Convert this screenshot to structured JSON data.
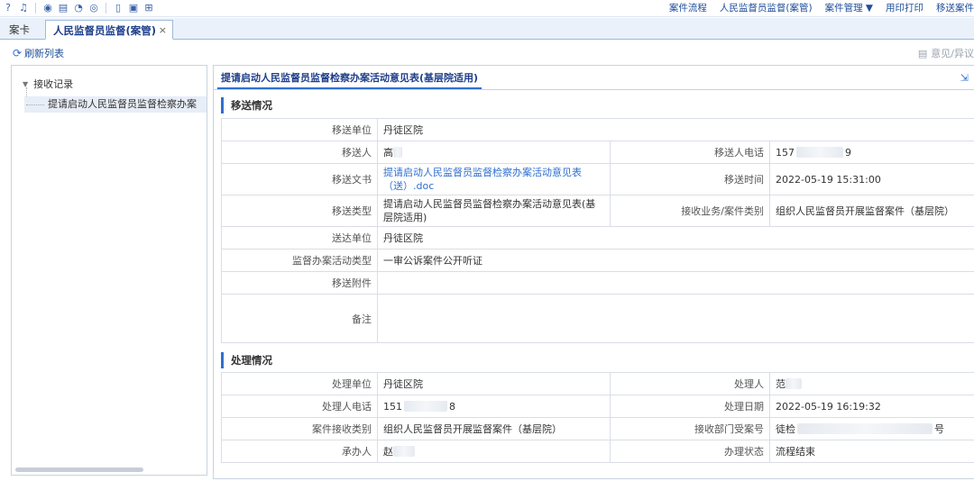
{
  "menu": {
    "items": [
      "案件流程",
      "人民监督员监督(案管)",
      "案件管理 ▼",
      "用印打印",
      "移送案件"
    ]
  },
  "tabs": {
    "tab1": "案卡",
    "tab2": "人民监督员监督(案管)",
    "close": "×"
  },
  "toolbar": {
    "refresh": "刷新列表",
    "opinion": "意见/异议"
  },
  "tree": {
    "root": "接收记录",
    "child": "提请启动人民监督员监督检察办案"
  },
  "form": {
    "tab_title": "提请启动人民监督员监督检察办案活动意见表(基层院适用)",
    "section1": "移送情况",
    "section2": "处理情况",
    "transfer": {
      "unit_label": "移送单位",
      "unit_value": "丹徒区院",
      "person_label": "移送人",
      "person_value": "高",
      "phone_label": "移送人电话",
      "phone_prefix": "157",
      "phone_suffix": "9",
      "doc_label": "移送文书",
      "doc_value": "提请启动人民监督员监督检察办案活动意见表（送）.doc",
      "time_label": "移送时间",
      "time_value": "2022-05-19 15:31:00",
      "type_label": "移送类型",
      "type_value": "提请启动人民监督员监督检察办案活动意见表(基层院适用)",
      "biz_label": "接收业务/案件类别",
      "biz_value": "组织人民监督员开展监督案件（基层院）",
      "deliver_label": "送达单位",
      "deliver_value": "丹徒区院",
      "activity_label": "监督办案活动类型",
      "activity_value": "一审公诉案件公开听证",
      "attach_label": "移送附件",
      "attach_value": "",
      "remark_label": "备注",
      "remark_value": ""
    },
    "process": {
      "unit_label": "处理单位",
      "unit_value": "丹徒区院",
      "person_label": "处理人",
      "person_value": "范",
      "phone_label": "处理人电话",
      "phone_prefix": "151",
      "phone_suffix": "8",
      "date_label": "处理日期",
      "date_value": "2022-05-19 16:19:32",
      "category_label": "案件接收类别",
      "category_value": "组织人民监督员开展监督案件（基层院）",
      "dept_label": "接收部门受案号",
      "dept_prefix": "徒检",
      "dept_suffix": "号",
      "handler_label": "承办人",
      "handler_value": "赵",
      "status_label": "办理状态",
      "status_value": "流程结束"
    }
  }
}
